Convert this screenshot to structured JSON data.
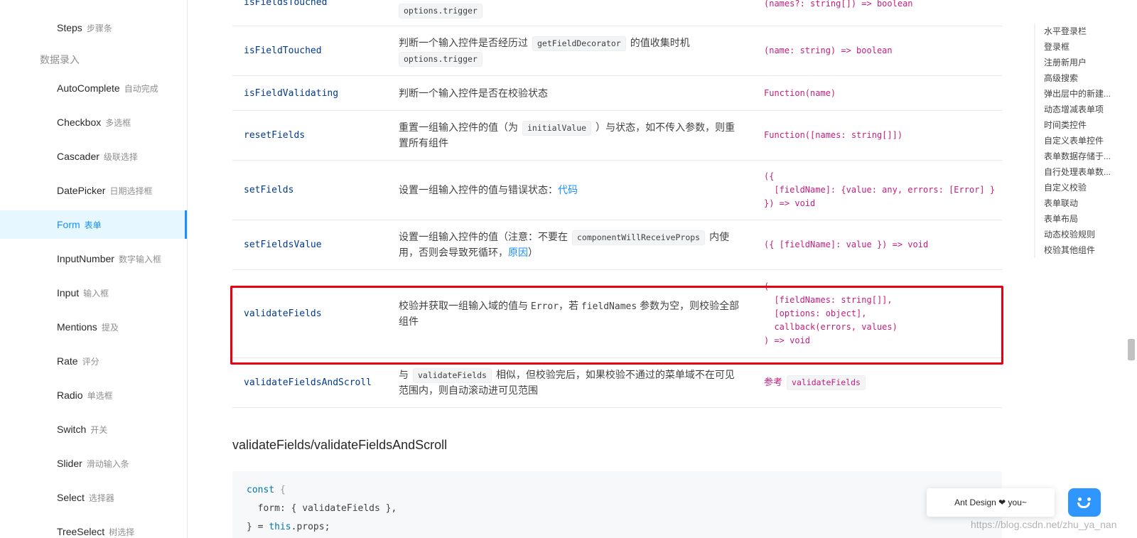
{
  "sidebar": {
    "group_label": "数据录入",
    "items": [
      {
        "label": "Steps",
        "zh": "步骤条"
      },
      {
        "label": "AutoComplete",
        "zh": "自动完成"
      },
      {
        "label": "Checkbox",
        "zh": "多选框"
      },
      {
        "label": "Cascader",
        "zh": "级联选择"
      },
      {
        "label": "DatePicker",
        "zh": "日期选择框"
      },
      {
        "label": "Form",
        "zh": "表单"
      },
      {
        "label": "InputNumber",
        "zh": "数字输入框"
      },
      {
        "label": "Input",
        "zh": "输入框"
      },
      {
        "label": "Mentions",
        "zh": "提及"
      },
      {
        "label": "Rate",
        "zh": "评分"
      },
      {
        "label": "Radio",
        "zh": "单选框"
      },
      {
        "label": "Switch",
        "zh": "开关"
      },
      {
        "label": "Slider",
        "zh": "滑动输入条"
      },
      {
        "label": "Select",
        "zh": "选择器"
      },
      {
        "label": "TreeSelect",
        "zh": "树选择"
      }
    ],
    "active": "Form"
  },
  "table": {
    "rows": [
      {
        "name": "isFieldsTouched",
        "code": "options.trigger",
        "type": "(names?: string[]) => boolean"
      },
      {
        "name": "isFieldTouched",
        "desc_a": "判断一个输入控件是否经历过",
        "code1": "getFieldDecorator",
        "desc_b": "的值收集时机",
        "code2": "options.trigger",
        "type": "(name: string) => boolean"
      },
      {
        "name": "isFieldValidating",
        "desc": "判断一个输入控件是否在校验状态",
        "type": "Function(name)"
      },
      {
        "name": "resetFields",
        "desc_a": "重置一组输入控件的值（为",
        "code": "initialValue",
        "desc_b": "）与状态，如不传入参数，则重置所有组件",
        "type": "Function([names: string[]])"
      },
      {
        "name": "setFields",
        "desc": "设置一组输入控件的值与错误状态：",
        "link": "代码",
        "type": "({\n  [fieldName]: {value: any, errors: [Error] }\n}) => void"
      },
      {
        "name": "setFieldsValue",
        "desc_a": "设置一组输入控件的值（注意：不要在",
        "code": "componentWillReceiveProps",
        "desc_b": "内使用，否则会导致死循环，",
        "link": "原因",
        "desc_c": "）",
        "type": "({ [fieldName]: value }) => void"
      },
      {
        "name": "validateFields",
        "desc_a": "校验并获取一组输入域的值与",
        "mono1": "Error",
        "desc_b": "，若",
        "mono2": "fieldNames",
        "desc_c": "参数为空，则校验全部组件",
        "type": "(\n  [fieldNames: string[]],\n  [options: object],\n  callback(errors, values)\n) => void"
      },
      {
        "name": "validateFieldsAndScroll",
        "desc_a": "与",
        "code": "validateFields",
        "desc_b": "相似，但校验完后，如果校验不通过的菜单域不在可见范围内，则自动滚动进可见范围",
        "type_prefix": "参考",
        "type_code": "validateFields"
      }
    ]
  },
  "section_title": "validateFields/validateFieldsAndScroll",
  "code_block": {
    "line1_kw": "const",
    "line1_rest": " {",
    "line2": "  form: { validateFields },",
    "line3_a": "} = ",
    "line3_kw": "this",
    "line3_b": ".props;"
  },
  "anchor_nav": [
    "水平登录栏",
    "登录框",
    "注册新用户",
    "高级搜索",
    "弹出层中的新建...",
    "动态增减表单项",
    "时间类控件",
    "自定义表单控件",
    "表单数据存储于...",
    "自行处理表单数...",
    "自定义校验",
    "表单联动",
    "表单布局",
    "动态校验规则",
    "校验其他组件"
  ],
  "widget": {
    "text": "Ant Design ❤ you~"
  },
  "watermark": "https://blog.csdn.net/zhu_ya_nan",
  "colors": {
    "accent": "#1890ff",
    "highlight": "#e60012",
    "type_color": "#c41d7f"
  }
}
